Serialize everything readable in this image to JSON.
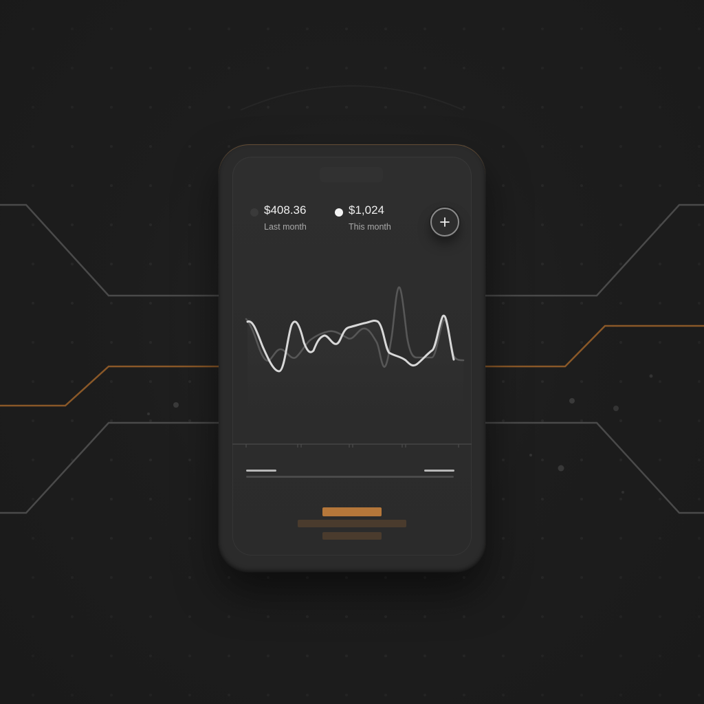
{
  "legend": [
    {
      "value": "$408.36",
      "label": "Last month",
      "dot_color": "#3a3a3a"
    },
    {
      "value": "$1,024",
      "label": "This month",
      "dot_color": "#f2f2f2"
    }
  ],
  "add_button": {
    "icon": "plus-icon"
  },
  "colors": {
    "accent": "#b5773a",
    "line_this_month": "#d8d8d8",
    "line_last_month": "#575757"
  }
}
